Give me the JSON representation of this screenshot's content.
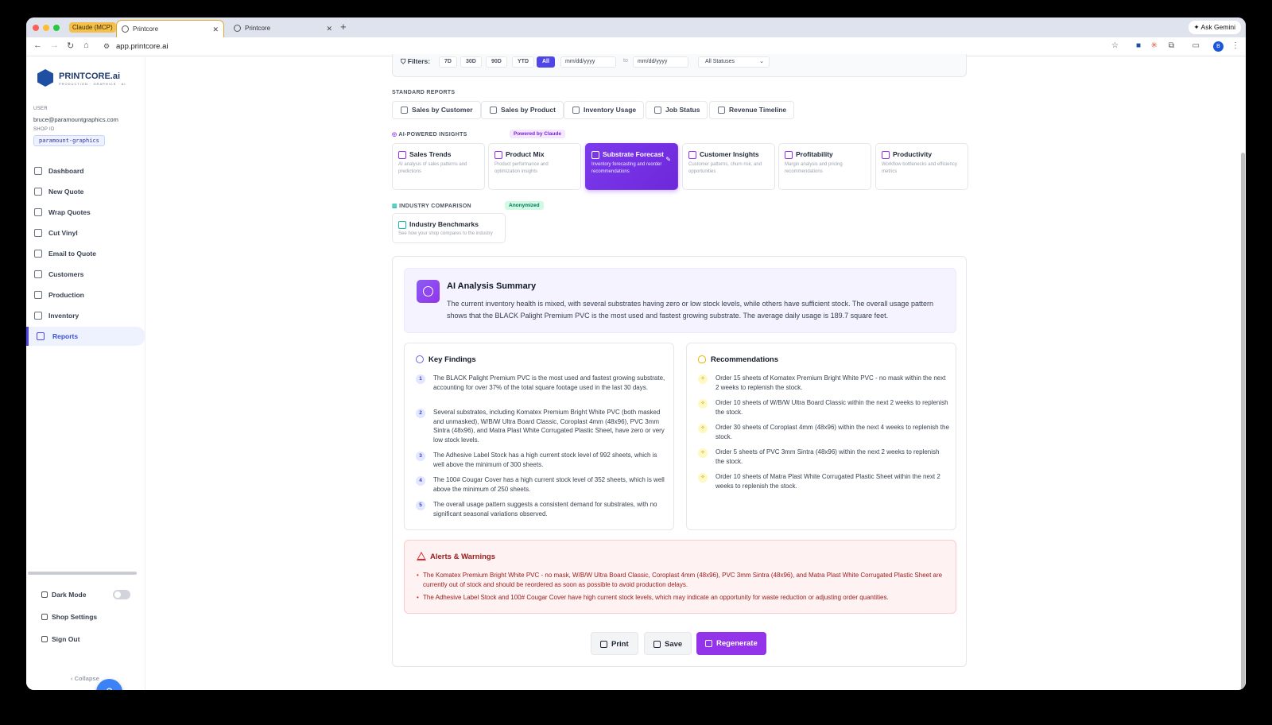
{
  "browser": {
    "tab_group": "Claude (MCP)",
    "tabs": [
      {
        "title": "Printcore"
      },
      {
        "title": "Printcore"
      }
    ],
    "url": "app.printcore.ai",
    "ask_gemini": "Ask Gemini",
    "profile_initial": "B"
  },
  "sidebar": {
    "logo_name": "PRINTCORE.ai",
    "logo_tagline": "PRODUCTION · GRAPHICS · AI",
    "user_label": "USER",
    "user_email": "bruce@paramountgraphics.com",
    "shop_label": "SHOP ID",
    "shop_id": "paramount-graphics",
    "nav": [
      {
        "label": "Dashboard"
      },
      {
        "label": "New Quote"
      },
      {
        "label": "Wrap Quotes"
      },
      {
        "label": "Cut Vinyl"
      },
      {
        "label": "Email to Quote"
      },
      {
        "label": "Customers"
      },
      {
        "label": "Production"
      },
      {
        "label": "Inventory"
      },
      {
        "label": "Reports"
      }
    ],
    "dark_mode": "Dark Mode",
    "shop_settings": "Shop Settings",
    "sign_out": "Sign Out",
    "collapse": "Collapse",
    "help_glyph": "?"
  },
  "filters": {
    "label": "Filters:",
    "ranges": [
      "7D",
      "30D",
      "90D",
      "YTD",
      "All"
    ],
    "selected": "All",
    "date_placeholder_from": "mm/dd/yyyy",
    "to": "to",
    "date_placeholder_to": "mm/dd/yyyy",
    "status": "All Statuses"
  },
  "standard_reports": {
    "title": "STANDARD REPORTS",
    "buttons": [
      {
        "label": "Sales by Customer"
      },
      {
        "label": "Sales by Product"
      },
      {
        "label": "Inventory Usage"
      },
      {
        "label": "Job Status"
      },
      {
        "label": "Revenue Timeline"
      }
    ]
  },
  "ai_insights": {
    "title": "AI-POWERED INSIGHTS",
    "badge": "Powered by Claude",
    "cards": [
      {
        "title": "Sales Trends",
        "desc": "AI analysis of sales patterns and predictions"
      },
      {
        "title": "Product Mix",
        "desc": "Product performance and optimization insights"
      },
      {
        "title": "Substrate Forecast",
        "desc": "Inventory forecasting and reorder recommendations"
      },
      {
        "title": "Customer Insights",
        "desc": "Customer patterns, churn risk, and opportunities"
      },
      {
        "title": "Profitability",
        "desc": "Margin analysis and pricing recommendations"
      },
      {
        "title": "Productivity",
        "desc": "Workflow bottlenecks and efficiency metrics"
      }
    ]
  },
  "industry": {
    "title": "INDUSTRY COMPARISON",
    "badge": "Anonymized",
    "card_title": "Industry Benchmarks",
    "card_desc": "See how your shop compares to the industry"
  },
  "report": {
    "summary_title": "AI Analysis Summary",
    "summary_text": "The current inventory health is mixed, with several substrates having zero or low stock levels, while others have sufficient stock. The overall usage pattern shows that the BLACK Palight Premium PVC is the most used and fastest growing substrate. The average daily usage is 189.7 square feet.",
    "findings_title": "Key Findings",
    "findings": [
      {
        "n": "1",
        "text": "The BLACK Palight Premium PVC is the most used and fastest growing substrate, accounting for over 37% of the total square footage used in the last 30 days."
      },
      {
        "n": "2",
        "text": "Several substrates, including Komatex Premium Bright White PVC (both masked and unmasked), W/B/W Ultra Board Classic, Coroplast 4mm (48x96), PVC 3mm Sintra (48x96), and Matra Plast White Corrugated Plastic Sheet, have zero or very low stock levels."
      },
      {
        "n": "3",
        "text": "The Adhesive Label Stock has a high current stock level of 992 sheets, which is well above the minimum of 300 sheets."
      },
      {
        "n": "4",
        "text": "The 100# Cougar Cover has a high current stock level of 352 sheets, which is well above the minimum of 250 sheets."
      },
      {
        "n": "5",
        "text": "The overall usage pattern suggests a consistent demand for substrates, with no significant seasonal variations observed."
      }
    ],
    "recs_title": "Recommendations",
    "recs": [
      {
        "text": "Order 15 sheets of Komatex Premium Bright White PVC - no mask within the next 2 weeks to replenish the stock."
      },
      {
        "text": "Order 10 sheets of W/B/W Ultra Board Classic within the next 2 weeks to replenish the stock."
      },
      {
        "text": "Order 30 sheets of Coroplast 4mm (48x96) within the next 4 weeks to replenish the stock."
      },
      {
        "text": "Order 5 sheets of PVC 3mm Sintra (48x96) within the next 2 weeks to replenish the stock."
      },
      {
        "text": "Order 10 sheets of Matra Plast White Corrugated Plastic Sheet within the next 2 weeks to replenish the stock."
      }
    ],
    "alerts_title": "Alerts & Warnings",
    "alerts": [
      {
        "text": "The Komatex Premium Bright White PVC - no mask, W/B/W Ultra Board Classic, Coroplast 4mm (48x96), PVC 3mm Sintra (48x96), and Matra Plast White Corrugated Plastic Sheet are currently out of stock and should be reordered as soon as possible to avoid production delays."
      },
      {
        "text": "The Adhesive Label Stock and 100# Cougar Cover have high current stock levels, which may indicate an opportunity for waste reduction or adjusting order quantities."
      }
    ],
    "actions": {
      "print": "Print",
      "save": "Save",
      "regenerate": "Regenerate"
    }
  },
  "colors": {
    "accent": "#9333ea",
    "nav_active": "#4f46e5",
    "alert": "#991b1b"
  }
}
